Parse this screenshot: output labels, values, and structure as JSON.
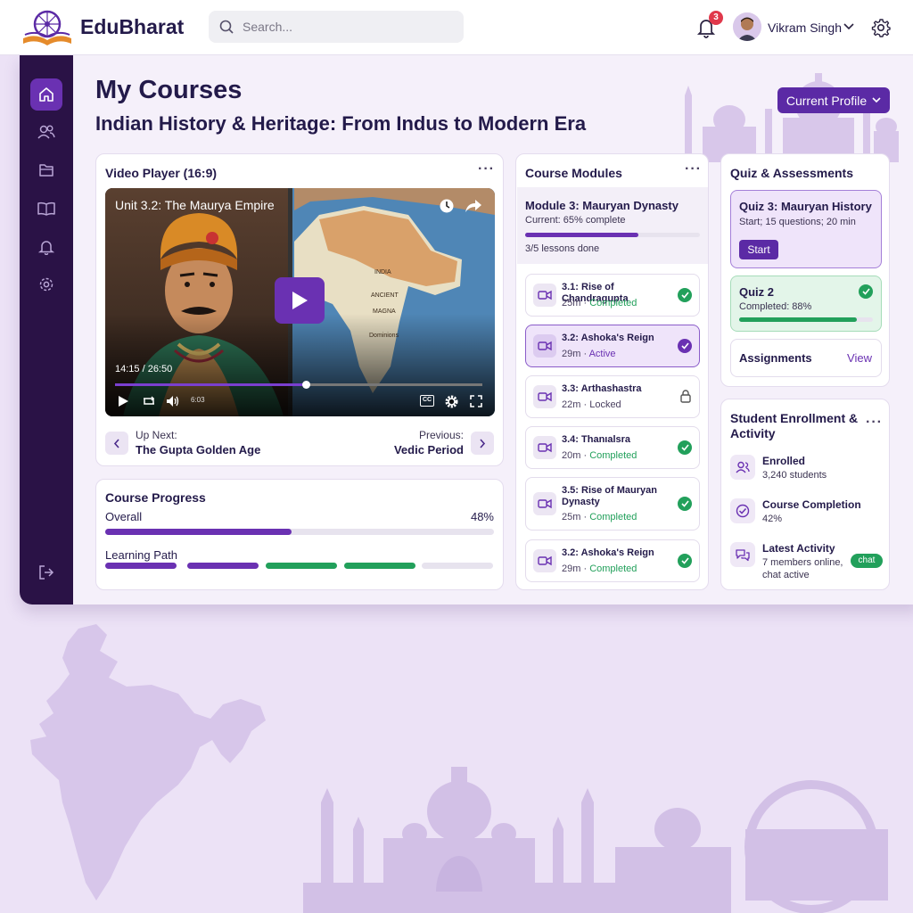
{
  "app": {
    "brand": "EduBharat"
  },
  "header": {
    "search_placeholder": "Search...",
    "notification_count": "3",
    "user_name": "Vikram Singh"
  },
  "sidebar": {
    "items": [
      {
        "icon": "home-icon",
        "active": true
      },
      {
        "icon": "users-icon",
        "active": false
      },
      {
        "icon": "folder-icon",
        "active": false
      },
      {
        "icon": "book-icon",
        "active": false
      },
      {
        "icon": "bell-icon",
        "active": false
      },
      {
        "icon": "gear-icon",
        "active": false
      },
      {
        "icon": "logout-icon",
        "active": false
      }
    ]
  },
  "page": {
    "title": "My Courses",
    "course_title": "Indian History & Heritage: From Indus to Modern Era",
    "profile_button": "Current Profile"
  },
  "video_card": {
    "title": "Video Player (16:9)",
    "video_title": "Unit 3.2: The Maurya Empire",
    "time": "14:15 / 26:50",
    "progress": 0.52,
    "small_readout": "6:03",
    "cc_label": "CC",
    "map_labels": [
      "INDIA",
      "ANCIENT",
      "MAGNA",
      "Dominions"
    ],
    "up_next_label": "Up Next:",
    "up_next_title": "The Gupta Golden Age",
    "previous_label": "Previous:",
    "previous_title": "Vedic Period"
  },
  "progress_card": {
    "title": "Course Progress",
    "overall_label": "Overall",
    "overall_value": "48%",
    "overall_fraction": 0.48,
    "path_label": "Learning Path",
    "path_segments": [
      "purple",
      "purple",
      "green",
      "green",
      "grey"
    ]
  },
  "modules_card": {
    "title": "Course Modules",
    "module_title": "Module 3: Mauryan Dynasty",
    "module_sub": "Current: 65% complete",
    "module_fraction": 0.65,
    "lessons_done": "3/5 lessons done",
    "lessons": [
      {
        "title": "3.1: Rise of Chandragupta",
        "duration": "25m",
        "status": "Completed",
        "state": "completed"
      },
      {
        "title": "3.2: Ashoka's Reign",
        "duration": "29m",
        "status": "Active",
        "state": "active"
      },
      {
        "title": "3.3: Arthashastra",
        "duration": "22m",
        "status": "Locked",
        "state": "locked"
      },
      {
        "title": "3.4: Thanıalsra",
        "duration": "20m",
        "status": "Completed",
        "state": "completed"
      },
      {
        "title": "3.5: Rise of Mauryan Dynasty",
        "duration": "25m",
        "status": "Completed",
        "state": "completed"
      },
      {
        "title": "3.2: Ashoka's Reign",
        "duration": "29m",
        "status": "Completed",
        "state": "completed"
      }
    ],
    "separator": "·"
  },
  "quiz_card": {
    "title": "Quiz & Assessments",
    "quiz3_title": "Quiz 3: Mauryan History",
    "quiz3_sub": "Start; 15 questions; 20 min",
    "start_label": "Start",
    "quiz2_title": "Quiz 2",
    "quiz2_sub": "Completed: 88%",
    "quiz2_fraction": 0.88,
    "assignments_label": "Assignments",
    "view_label": "View"
  },
  "activity_card": {
    "title": "Student Enrollment & Activity",
    "enrolled_title": "Enrolled",
    "enrolled_sub": "3,240 students",
    "completion_title": "Course Completion",
    "completion_sub": "42%",
    "latest_title": "Latest Activity",
    "latest_sub_1": "7 members online,",
    "latest_sub_2": "chat active",
    "chat_badge": "chat"
  },
  "colors": {
    "accent": "#6a31b2",
    "sidebar": "#2a1246",
    "success": "#22a05b",
    "background": "#ece2f6"
  }
}
